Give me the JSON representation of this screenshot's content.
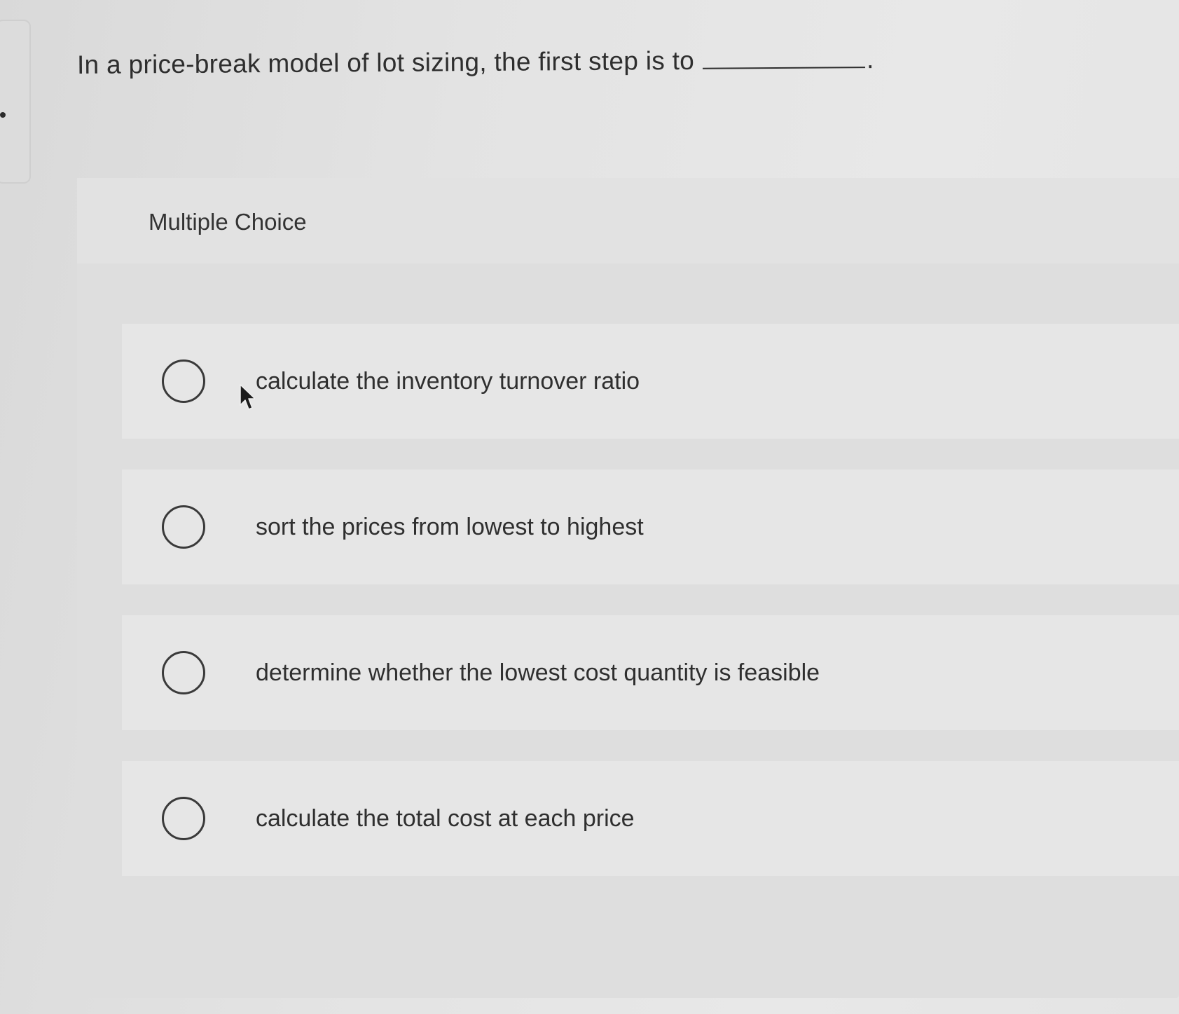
{
  "question": {
    "text": "In a price-break model of lot sizing, the first step is to",
    "end_punctuation": "."
  },
  "section": {
    "label": "Multiple Choice"
  },
  "options": [
    {
      "label": "calculate the inventory turnover ratio",
      "selected": false
    },
    {
      "label": "sort the prices from lowest to highest",
      "selected": false
    },
    {
      "label": "determine whether the lowest cost quantity is feasible",
      "selected": false
    },
    {
      "label": "calculate the total cost at each price",
      "selected": false
    }
  ],
  "icons": {
    "radio": "radio-empty-icon",
    "pointer": "mouse-pointer-icon"
  },
  "colors": {
    "text": "#2e2e2e",
    "panel": "#dedede",
    "option_bg": "#e6e6e6",
    "radio_border": "#3a3a3a"
  }
}
